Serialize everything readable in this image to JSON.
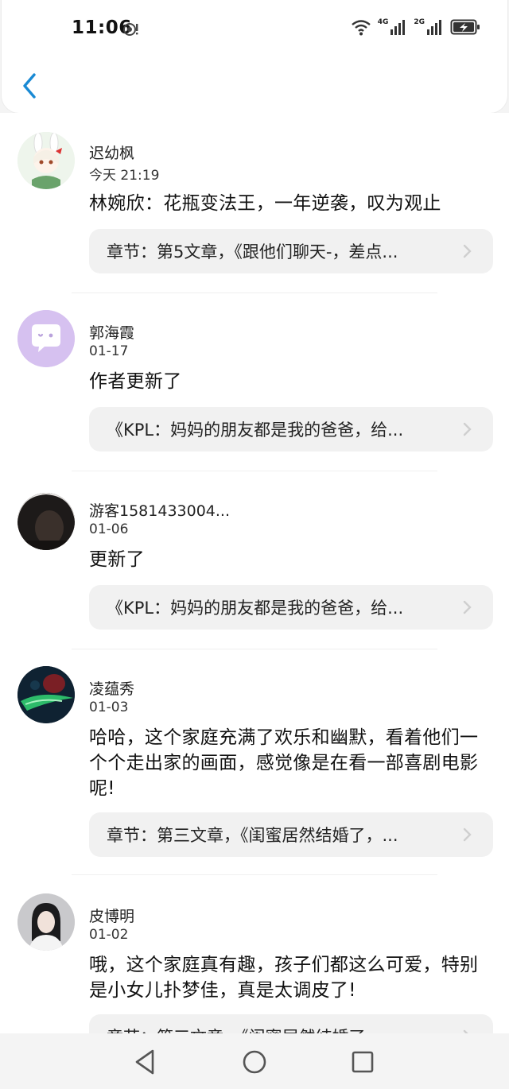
{
  "status_bar": {
    "time": "11:06",
    "network_1": "4G",
    "network_2": "2G",
    "icons": [
      "location-icon",
      "wifi-icon",
      "signal-icon",
      "battery-charging-icon"
    ]
  },
  "header": {
    "back_icon": "chevron-left-icon",
    "accent": "#1a8ad4"
  },
  "comments": [
    {
      "user": "迟幼枫",
      "time": "今天 21:19",
      "text": "林婉欣：花瓶变法王，一年逆袭，叹为观止",
      "ref": "章节：第5文章，《跟他们聊天-，差点..."
    },
    {
      "user": "郭海霞",
      "time": "01-17",
      "text": "作者更新了",
      "ref": "《KPL：妈妈的朋友都是我的爸爸，给..."
    },
    {
      "user": "游客1581433004...",
      "time": "01-06",
      "text": "更新了",
      "ref": "《KPL：妈妈的朋友都是我的爸爸，给..."
    },
    {
      "user": "凌蕴秀",
      "time": "01-03",
      "text": "哈哈，这个家庭充满了欢乐和幽默，看着他们一个个走出家的画面，感觉像是在看一部喜剧电影呢!",
      "ref": "章节：第三文章，《闺蜜居然结婚了，..."
    },
    {
      "user": "皮博明",
      "time": "01-02",
      "text": "哦，这个家庭真有趣，孩子们都这么可爱，特别是小女儿扑梦佳，真是太调皮了!",
      "ref": "章节：第三文章，《闺蜜居然结婚了，..."
    }
  ],
  "navbar": {
    "icons": [
      "back-triangle-icon",
      "home-circle-icon",
      "recents-square-icon"
    ]
  }
}
